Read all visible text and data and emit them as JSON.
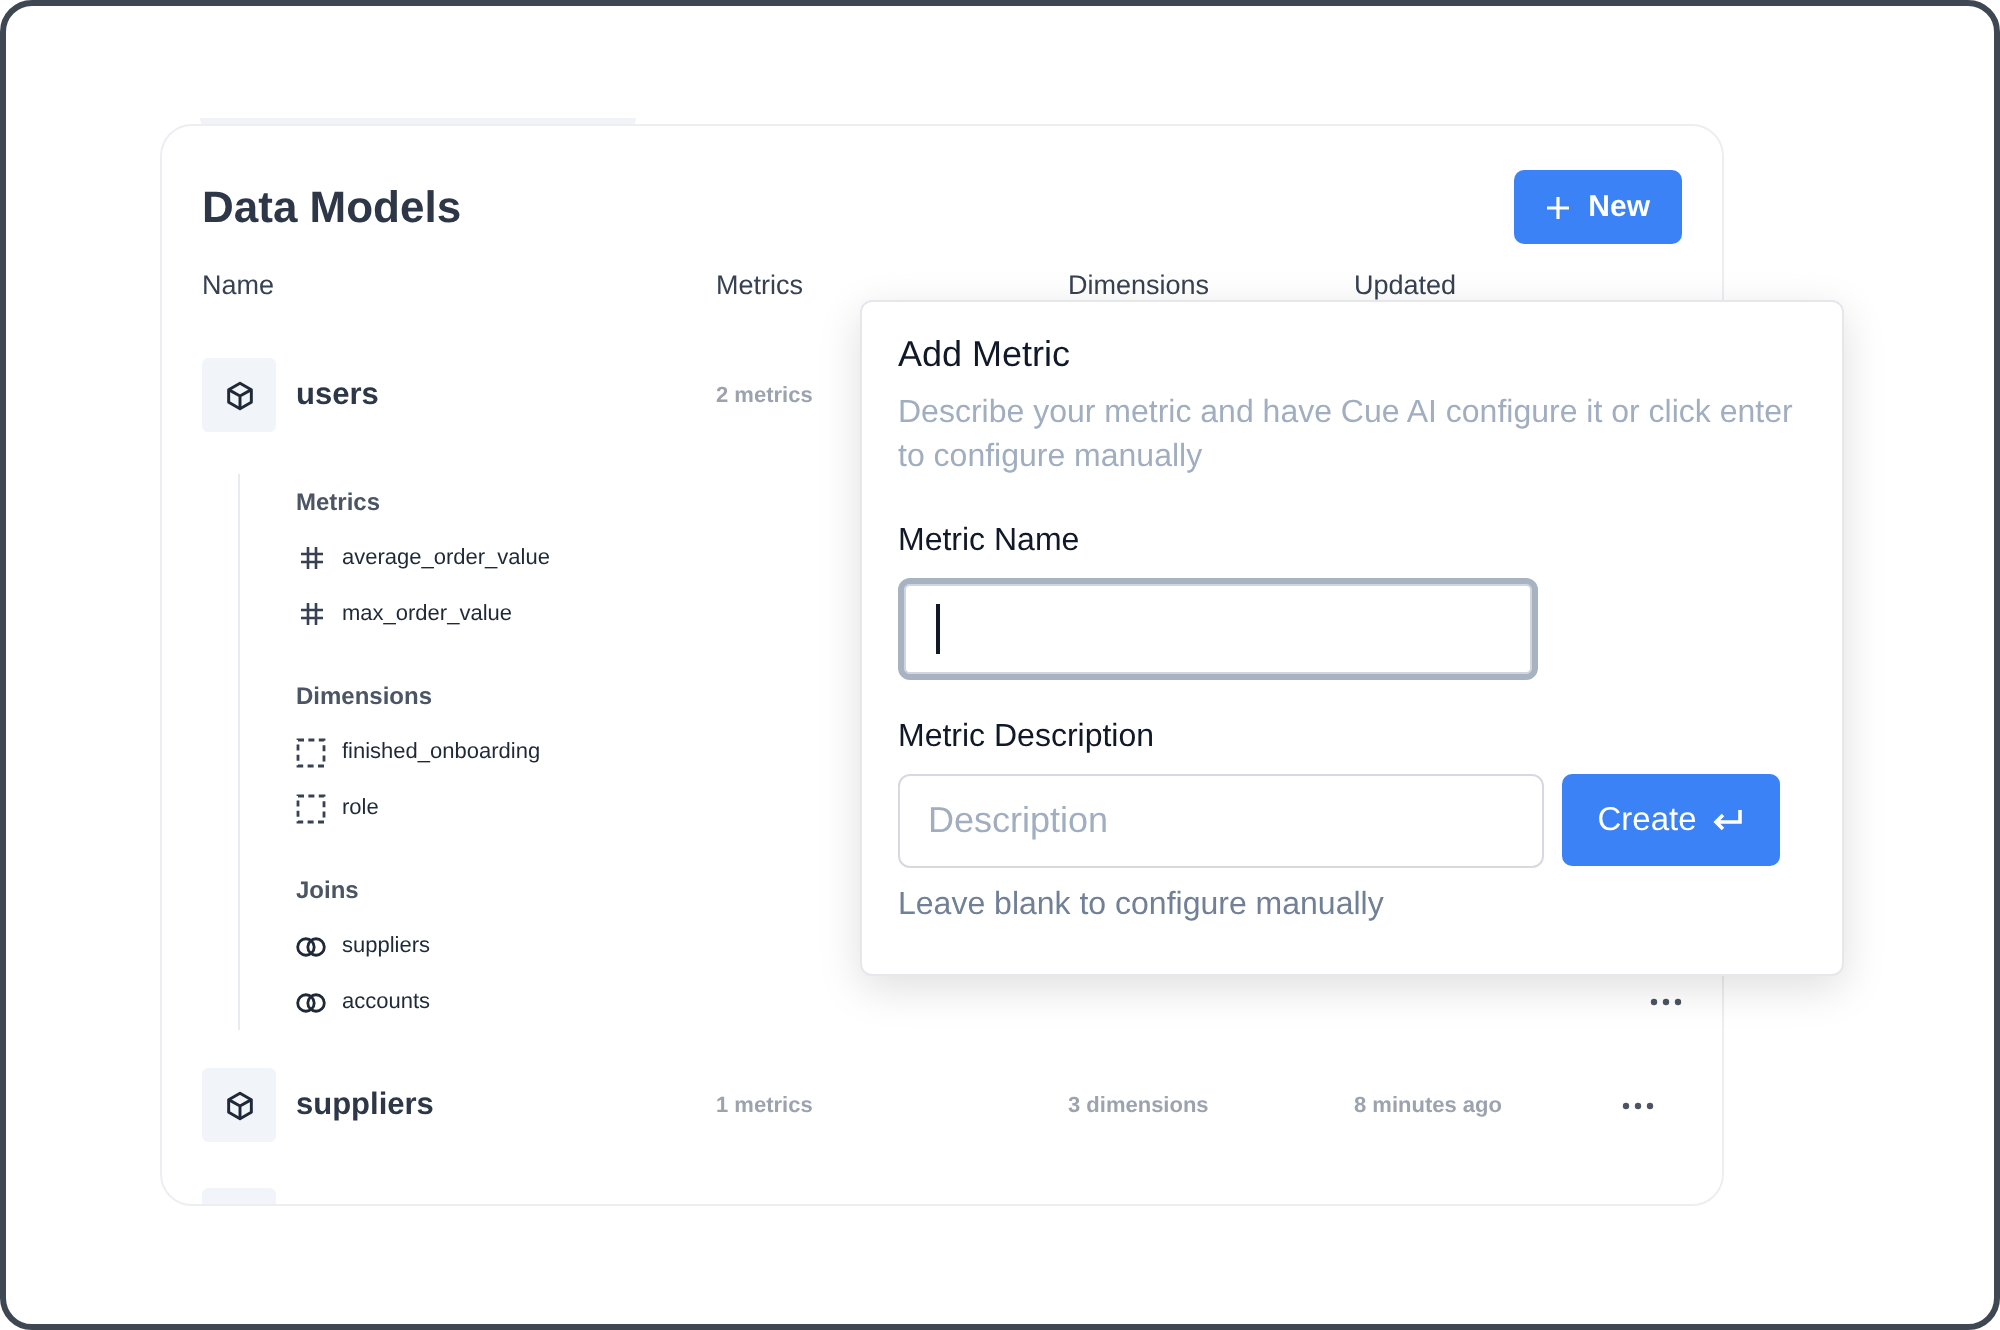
{
  "title": "Data Models",
  "new_button": {
    "label": "New"
  },
  "columns": [
    "Name",
    "Metrics",
    "Dimensions",
    "Updated"
  ],
  "models": [
    {
      "name": "users",
      "metrics": "2 metrics",
      "sections": [
        {
          "kind": "metrics",
          "label": "Metrics",
          "items": [
            {
              "name": "average_order_value"
            },
            {
              "name": "max_order_value"
            }
          ]
        },
        {
          "kind": "dimensions",
          "label": "Dimensions",
          "items": [
            {
              "name": "finished_onboarding"
            },
            {
              "name": "role"
            }
          ]
        },
        {
          "kind": "joins",
          "label": "Joins",
          "items": [
            {
              "name": "suppliers"
            },
            {
              "name": "accounts"
            }
          ]
        }
      ]
    },
    {
      "name": "suppliers",
      "metrics": "1 metrics",
      "dimensions": "3 dimensions",
      "updated": "8 minutes ago"
    }
  ],
  "add_metric": {
    "title": "Add Metric",
    "description": "Describe your metric and have Cue AI configure it or click enter to configure manually",
    "name_field": {
      "label": "Metric Name",
      "focused": true
    },
    "description_field": {
      "label": "Metric Description",
      "placeholder": "Description"
    },
    "create_button": {
      "label": "Create"
    },
    "hint": "Leave blank to configure manually"
  }
}
